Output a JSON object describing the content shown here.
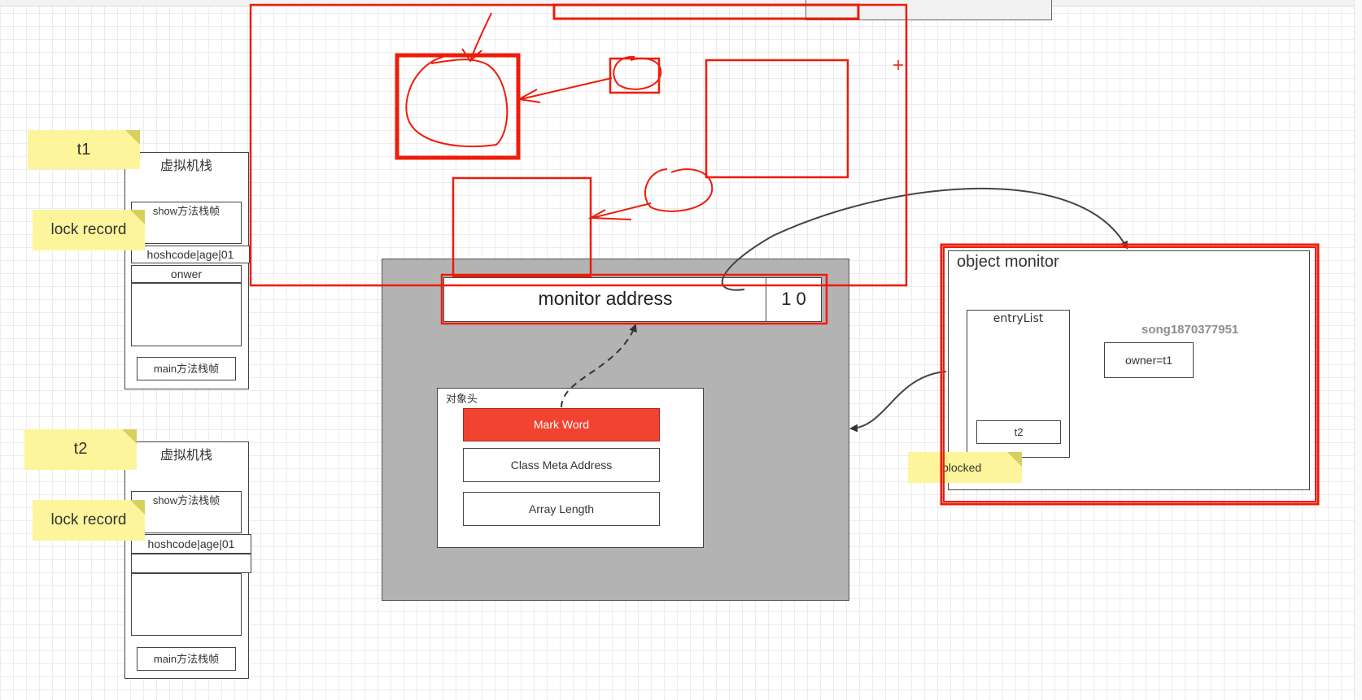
{
  "threads": [
    {
      "sticky": "t1",
      "lock_note": "lock record",
      "stack_title": "虚拟机栈",
      "frame_show": "show方法栈帧",
      "hash_row": "hoshcode|age|01",
      "owner_row": "onwer",
      "frame_main": "main方法栈帧"
    },
    {
      "sticky": "t2",
      "lock_note": "lock record",
      "stack_title": "虚拟机栈",
      "frame_show": "show方法栈帧",
      "hash_row": "hoshcode|age|01",
      "owner_row": "",
      "frame_main": "main方法栈帧"
    }
  ],
  "object": {
    "monitor_address": "monitor address",
    "lock_bits": "1 0",
    "header_title": "对象头",
    "mark_word": "Mark Word",
    "class_meta": "Class Meta Address",
    "array_length": "Array Length"
  },
  "monitor": {
    "title": "object monitor",
    "entry_list": "entryList",
    "entry_item": "t2",
    "owner": "owner=t1",
    "watermark": "song1870377951",
    "blocked": "blocked"
  },
  "colors": {
    "annotation_red": "#ee1c0a",
    "mark_word_fill": "#f24330",
    "object_fill": "#b3b3b3",
    "sticky_yellow": "#fdf59b"
  }
}
